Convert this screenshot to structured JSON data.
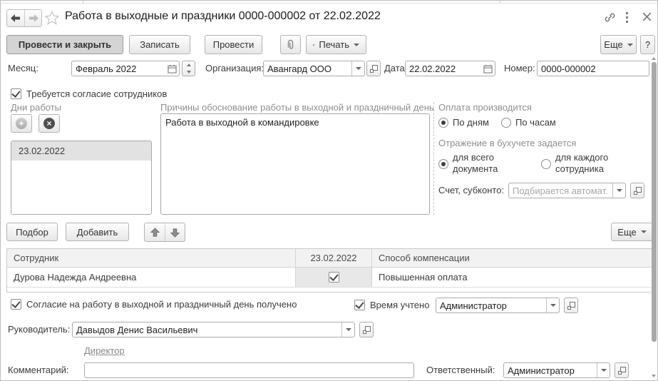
{
  "titlebar": {
    "title": "Работа в выходные и праздники 0000-000002 от 22.02.2022"
  },
  "toolbar": {
    "post_and_close": "Провести и закрыть",
    "save": "Записать",
    "post": "Провести",
    "print": "Печать",
    "more": "Еще",
    "help": "?"
  },
  "header_fields": {
    "month_label": "Месяц:",
    "month_value": "Февраль 2022",
    "org_label": "Организация:",
    "org_value": "Авангард ООО",
    "date_label": "Дата:",
    "date_value": "22.02.2022",
    "number_label": "Номер:",
    "number_value": "0000-000002"
  },
  "consent": {
    "label": "Требуется согласие сотрудников",
    "checked": true
  },
  "work_days": {
    "caption": "Дни работы",
    "items": [
      "23.02.2022"
    ]
  },
  "reasons": {
    "caption": "Причины обоснование работы в выходной и праздничный день",
    "value": "Работа в выходной в командировке"
  },
  "payment": {
    "caption": "Оплата производится",
    "options": [
      {
        "label": "По дням",
        "selected": true
      },
      {
        "label": "По часам",
        "selected": false
      }
    ]
  },
  "reflection": {
    "caption": "Отражение в бухучете задается",
    "options": [
      {
        "label": "для всего документа",
        "selected": true
      },
      {
        "label": "для каждого сотрудника",
        "selected": false
      }
    ]
  },
  "account": {
    "label": "Счет, субконто:",
    "placeholder": "Подбирается автомат..."
  },
  "table_toolbar": {
    "pick": "Подбор",
    "add": "Добавить",
    "more": "Еще"
  },
  "employees_table": {
    "headers": [
      "Сотрудник",
      "23.02.2022",
      "Способ компенсации"
    ],
    "rows": [
      {
        "employee": "Дурова Надежда Андреевна",
        "day_checked": true,
        "compensation": "Повышенная оплата"
      }
    ]
  },
  "footer": {
    "agreement_label": "Согласие на работу в выходной и праздничный день получено",
    "agreement_checked": true,
    "time_recorded_label": "Время учтено",
    "time_recorded_checked": true,
    "time_recorded_value": "Администратор",
    "manager_label": "Руководитель:",
    "manager_value": "Давыдов Денис Васильевич",
    "manager_position_link": "Директор",
    "comment_label": "Комментарий:",
    "comment_value": "",
    "responsible_label": "Ответственный:",
    "responsible_value": "Администратор"
  },
  "colors": {
    "primary_button_bg": "#d4d4d4",
    "table_header_bg": "#f2f2f2",
    "selected_item_bg": "#e2e2e2",
    "link_gray": "#8a8a8a"
  }
}
